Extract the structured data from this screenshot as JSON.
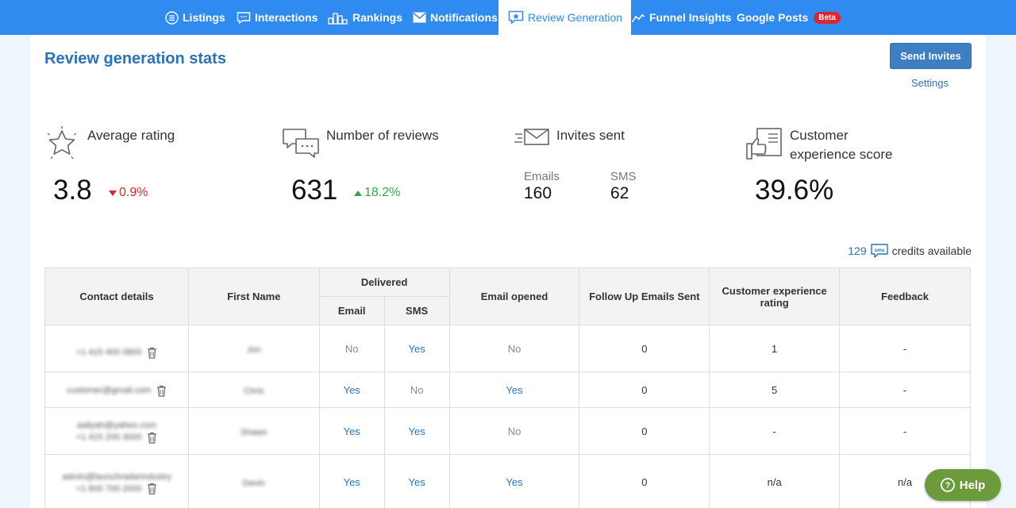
{
  "nav": {
    "items": [
      {
        "label": "Listings",
        "icon": "list-icon"
      },
      {
        "label": "Interactions",
        "icon": "chat-icon"
      },
      {
        "label": "Rankings",
        "icon": "bar-chart-icon"
      },
      {
        "label": "Notifications",
        "icon": "envelope-icon"
      },
      {
        "label": "Review Generation",
        "icon": "star-chat-icon",
        "active": true
      },
      {
        "label": "Funnel Insights",
        "icon": "trend-icon"
      },
      {
        "label": "Google Posts",
        "icon": "none",
        "badge": "Beta"
      }
    ]
  },
  "page": {
    "title": "Review generation stats",
    "send_invites_label": "Send Invites",
    "settings_label": "Settings"
  },
  "stats": {
    "average_rating": {
      "label": "Average rating",
      "value": "3.8",
      "delta": "0.9%",
      "direction": "down"
    },
    "number_of_reviews": {
      "label": "Number of reviews",
      "value": "631",
      "delta": "18.2%",
      "direction": "up"
    },
    "invites_sent": {
      "label": "Invites sent",
      "emails_label": "Emails",
      "emails_value": "160",
      "sms_label": "SMS",
      "sms_value": "62"
    },
    "customer_experience": {
      "label_line1": "Customer",
      "label_line2": "experience score",
      "value": "39.6%"
    }
  },
  "credits": {
    "count": "129",
    "icon_text": "sms",
    "label": "credits available"
  },
  "table": {
    "headers": {
      "contact_details": "Contact details",
      "first_name": "First Name",
      "delivered": "Delivered",
      "email": "Email",
      "sms": "SMS",
      "email_opened": "Email opened",
      "follow_up": "Follow Up Emails Sent",
      "cx_rating": "Customer experience rating",
      "feedback": "Feedback"
    },
    "rows": [
      {
        "contact_line1": "+1 415 400 0800",
        "contact_line2": "",
        "first_name": "Jon",
        "email": "No",
        "sms": "Yes",
        "email_opened": "No",
        "follow_up": "0",
        "cx_rating": "1",
        "feedback": "-"
      },
      {
        "contact_line1": "customer@gmail.com",
        "contact_line2": "",
        "first_name": "Chris",
        "email": "Yes",
        "sms": "No",
        "email_opened": "Yes",
        "follow_up": "0",
        "cx_rating": "5",
        "feedback": "-"
      },
      {
        "contact_line1": "aaliyah@yahoo.com",
        "contact_line2": "+1 415 200 3000",
        "first_name": "Shawn",
        "email": "Yes",
        "sms": "Yes",
        "email_opened": "No",
        "follow_up": "0",
        "cx_rating": "-",
        "feedback": "-"
      },
      {
        "contact_line1": "admin@launchradarindustry",
        "contact_line2": "+1 800 700 2000",
        "first_name": "Devin",
        "email": "Yes",
        "sms": "Yes",
        "email_opened": "Yes",
        "follow_up": "0",
        "cx_rating": "n/a",
        "feedback": "n/a"
      }
    ]
  },
  "help": {
    "label": "Help",
    "icon_glyph": "?"
  },
  "colors": {
    "nav_bg": "#2f8bef",
    "title": "#2b72b8",
    "down": "#e0232e",
    "up": "#2eaa4a",
    "help": "#6b9b3a"
  }
}
